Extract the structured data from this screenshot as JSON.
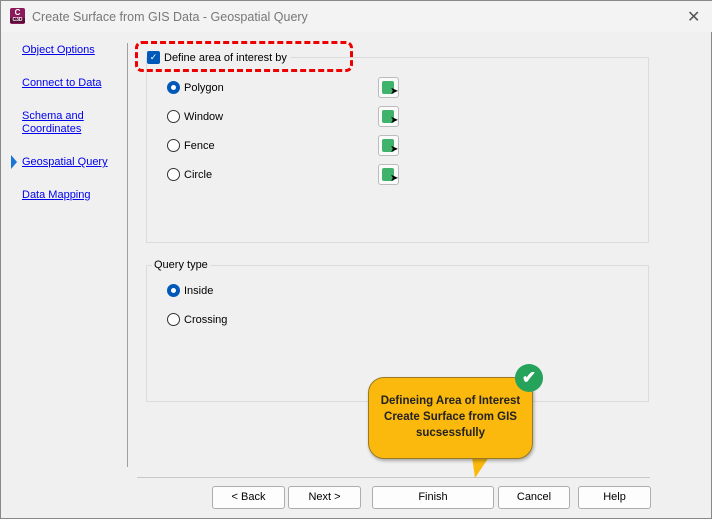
{
  "window": {
    "title": "Create Surface from GIS Data - Geospatial Query",
    "app_icon_text": "C",
    "app_icon_sub": "C3D",
    "close": "✕"
  },
  "nav": {
    "items": [
      "Object Options",
      "Connect to Data",
      "Schema and Coordinates",
      "Geospatial Query",
      "Data Mapping"
    ],
    "active": "Geospatial Query"
  },
  "area": {
    "checkbox_label": "Define area of interest by",
    "checked": true,
    "options": [
      "Polygon",
      "Window",
      "Fence",
      "Circle"
    ],
    "selected": "Polygon"
  },
  "query": {
    "label": "Query type",
    "options": [
      "Inside",
      "Crossing"
    ],
    "selected": "Inside"
  },
  "buttons": {
    "back": "< Back",
    "next": "Next >",
    "finish": "Finish",
    "cancel": "Cancel",
    "help": "Help"
  },
  "callout": {
    "text": "Defineing Area of Interest Create Surface from GIS sucsessfully",
    "color": "#fbb80d"
  }
}
